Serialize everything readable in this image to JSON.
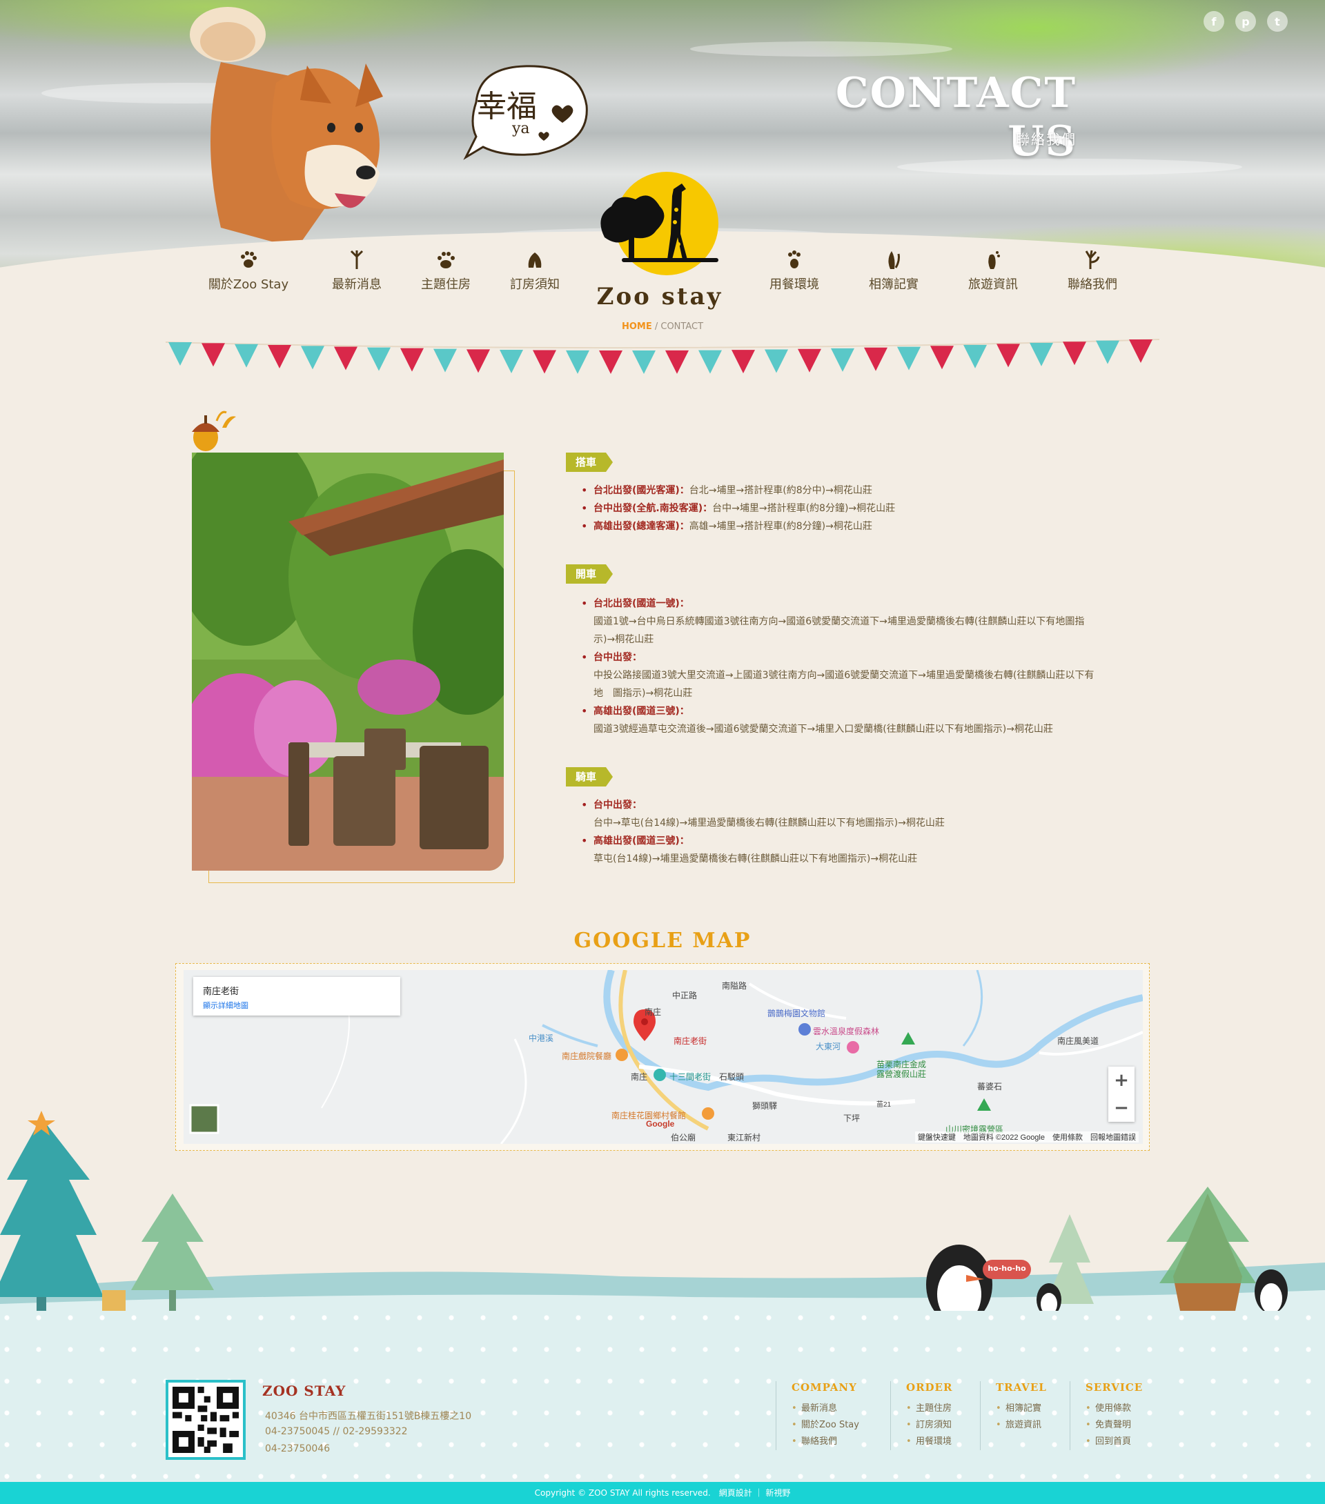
{
  "hero": {
    "title": "CONTACT US",
    "subtitle": "聯絡我們",
    "bubble_text": "幸福",
    "bubble_sub": "ya",
    "social": [
      {
        "icon": "facebook-icon",
        "glyph": "f"
      },
      {
        "icon": "pinterest-icon",
        "glyph": "p"
      },
      {
        "icon": "twitter-icon",
        "glyph": "t"
      }
    ]
  },
  "nav": {
    "logo_text": "Zoo stay",
    "items": [
      "關於Zoo Stay",
      "最新消息",
      "主題住房",
      "訂房須知",
      "用餐環境",
      "相簿記實",
      "旅遊資訊",
      "聯絡我們"
    ]
  },
  "breadcrumb": {
    "home": "HOME",
    "separator": "/",
    "current": "CONTACT"
  },
  "sections": [
    {
      "tag": "搭車",
      "items": [
        {
          "label": "台北出發(國光客運)：",
          "text": "台北→埔里→搭計程車(約8分中)→桐花山莊"
        },
        {
          "label": "台中出發(全航.南投客運)：",
          "text": "台中→埔里→搭計程車(約8分鐘)→桐花山莊"
        },
        {
          "label": "高雄出發(總達客運)：",
          "text": "高雄→埔里→搭計程車(約8分鐘)→桐花山莊"
        }
      ]
    },
    {
      "tag": "開車",
      "items": [
        {
          "label": "台北出發(國道一號)：",
          "detail": [
            "國道1號→台中烏日系統轉國道3號往南方向→國道6號愛蘭交流道下→埔里過愛蘭橋後右轉(往麒麟山莊以下有地圖指",
            "示)→桐花山莊"
          ]
        },
        {
          "label": "台中出發：",
          "detail": [
            "中投公路接國道3號大里交流道→上國道3號往南方向→國道6號愛蘭交流道下→埔里過愛蘭橋後右轉(往麒麟山莊以下有",
            "地　圖指示)→桐花山莊"
          ]
        },
        {
          "label": "高雄出發(國道三號)：",
          "detail": [
            "國道3號經過草屯交流道後→國道6號愛蘭交流道下→埔里入口愛蘭橋(往麒麟山莊以下有地圖指示)→桐花山莊"
          ]
        }
      ]
    },
    {
      "tag": "騎車",
      "items": [
        {
          "label": "台中出發：",
          "detail": [
            "台中→草屯(台14線)→埔里過愛蘭橋後右轉(往麒麟山莊以下有地圖指示)→桐花山莊"
          ]
        },
        {
          "label": "高雄出發(國道三號)：",
          "detail": [
            "草屯(台14線)→埔里過愛蘭橋後右轉(往麒麟山莊以下有地圖指示)→桐花山莊"
          ]
        }
      ]
    }
  ],
  "map": {
    "title": "GOOGLE MAP",
    "info_name": "南庄老街",
    "info_link": "顯示詳細地圖",
    "labels": {
      "l1": "南庄",
      "l2": "南庄老街",
      "l3": "南庄戲院餐廳",
      "l4": "十三間老街",
      "l5": "石駁頭",
      "l6": "獅頭驛",
      "l7": "南庄桂花園鄉村餐館",
      "l8": "伯公廟",
      "l9": "東江新村",
      "l10": "下坪",
      "l11": "鵲鵲梅園文物館",
      "l12": "雲水溫泉度假森林",
      "l13": "苗栗南庄金成",
      "l13b": "露營渡假山莊",
      "l14": "蕃婆石",
      "l15": "山川密境露營區",
      "l16": "大東河",
      "l17": "中港溪",
      "l18": "中正路",
      "l19": "南庄風美道",
      "l20": "南庄",
      "l21": "南隘路",
      "l22": "苗21"
    },
    "zoom_in": "+",
    "zoom_out": "−",
    "google": "Google",
    "footer": "鍵盤快速鍵　地圖資料 ©2022 Google　使用條款　回報地圖錯誤"
  },
  "footer": {
    "brand": "ZOO STAY",
    "address": "40346 台中市西區五權五街151號B棟五樓之10",
    "phone": "04-23750045 // 02-29593322",
    "fax": "04-23750046",
    "speech": "ho-ho-ho",
    "cols": [
      {
        "title": "COMPANY",
        "items": [
          "最新消息",
          "關於Zoo Stay",
          "聯絡我們"
        ]
      },
      {
        "title": "ORDER",
        "items": [
          "主題住房",
          "訂房須知",
          "用餐環境"
        ]
      },
      {
        "title": "TRAVEL",
        "items": [
          "相簿記實",
          "旅遊資訊"
        ]
      },
      {
        "title": "SERVICE",
        "items": [
          "使用條款",
          "免責聲明",
          "回到首頁"
        ]
      }
    ],
    "copyright": "Copyright © ZOO STAY All rights reserved.　網頁設計 ｜ 新視野"
  },
  "colors": {
    "accent": "#e8a016",
    "tag": "#b7b82a",
    "footer_bar": "#19d3d4"
  }
}
